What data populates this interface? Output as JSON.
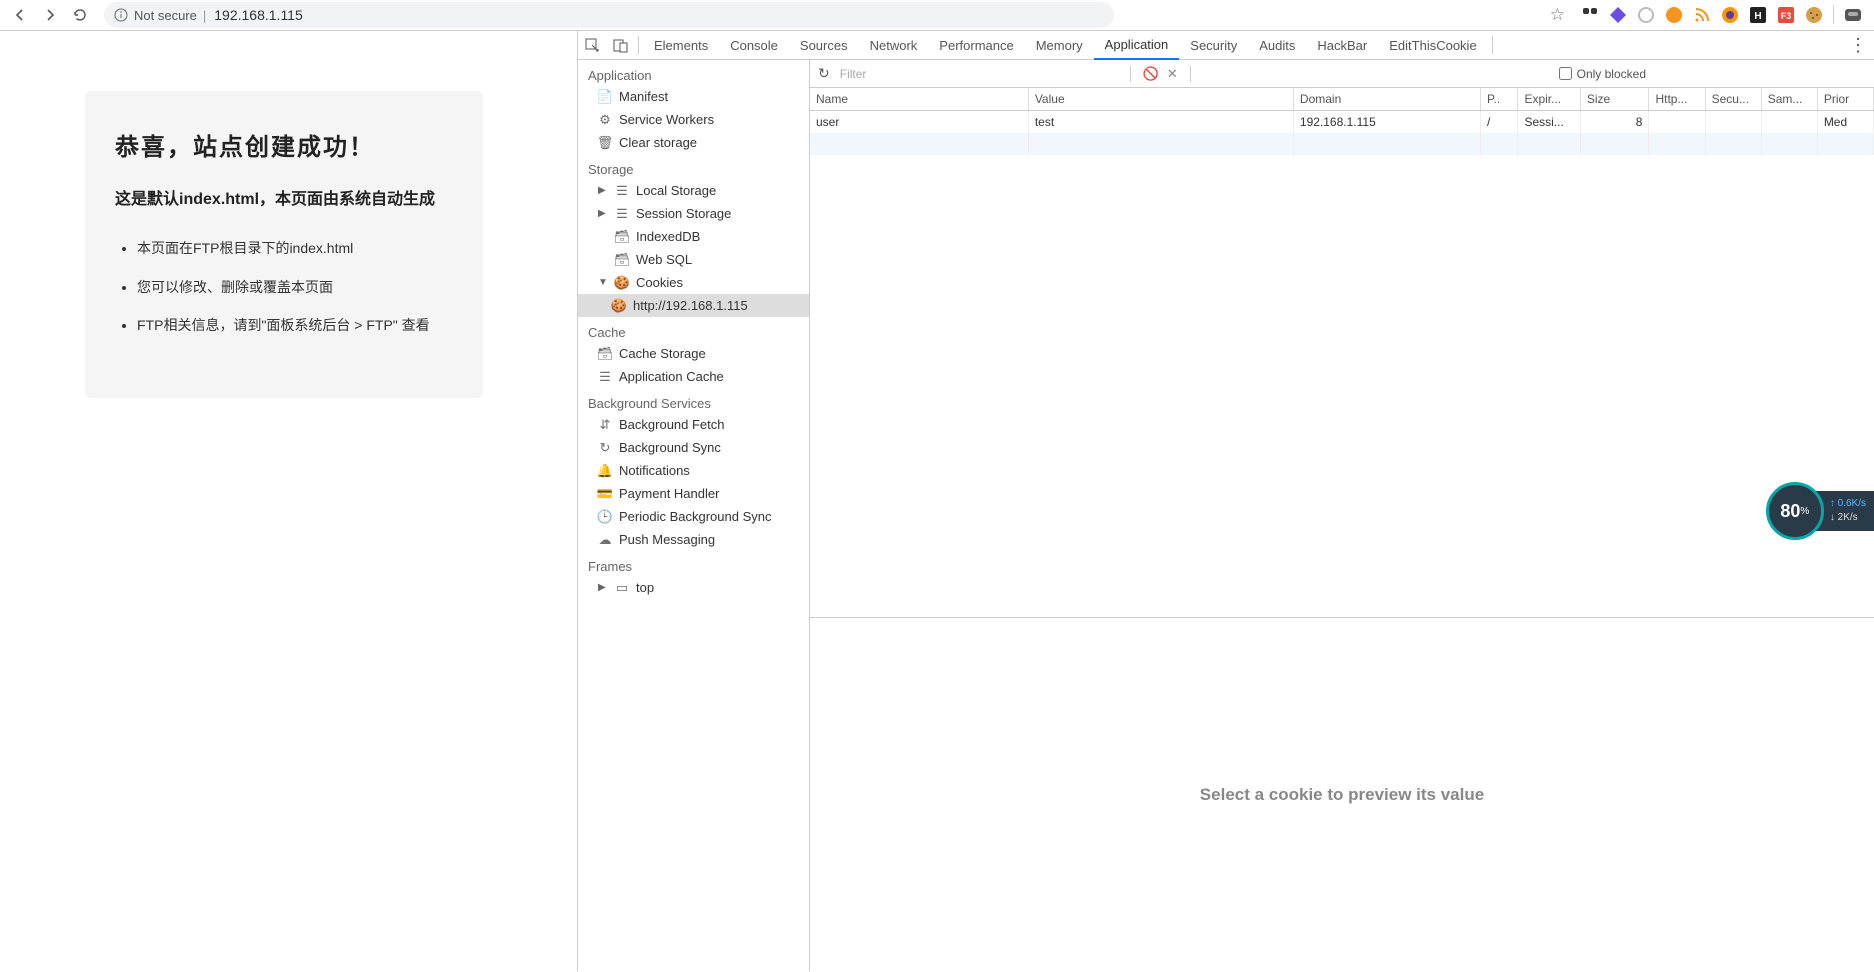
{
  "browser": {
    "not_secure": "Not secure",
    "url": "192.168.1.115"
  },
  "page": {
    "title": "恭喜，站点创建成功！",
    "subtitle": "这是默认index.html，本页面由系统自动生成",
    "items": [
      "本页面在FTP根目录下的index.html",
      "您可以修改、删除或覆盖本页面",
      "FTP相关信息，请到\"面板系统后台 > FTP\" 查看"
    ]
  },
  "devtools": {
    "tabs": [
      "Elements",
      "Console",
      "Sources",
      "Network",
      "Performance",
      "Memory",
      "Application",
      "Security",
      "Audits",
      "HackBar",
      "EditThisCookie"
    ],
    "active_tab": "Application",
    "sidebar": {
      "application": {
        "label": "Application",
        "items": [
          "Manifest",
          "Service Workers",
          "Clear storage"
        ]
      },
      "storage": {
        "label": "Storage",
        "items": [
          "Local Storage",
          "Session Storage",
          "IndexedDB",
          "Web SQL",
          "Cookies"
        ],
        "cookie_origin": "http://192.168.1.115"
      },
      "cache": {
        "label": "Cache",
        "items": [
          "Cache Storage",
          "Application Cache"
        ]
      },
      "bg": {
        "label": "Background Services",
        "items": [
          "Background Fetch",
          "Background Sync",
          "Notifications",
          "Payment Handler",
          "Periodic Background Sync",
          "Push Messaging"
        ]
      },
      "frames": {
        "label": "Frames",
        "items": [
          "top"
        ]
      }
    },
    "filter": {
      "placeholder": "Filter",
      "only_blocked": "Only blocked"
    },
    "table": {
      "cols": [
        "Name",
        "Value",
        "Domain",
        "P..",
        "Expir...",
        "Size",
        "Http...",
        "Secu...",
        "Sam...",
        "Prior"
      ],
      "widths": [
        140,
        170,
        120,
        24,
        40,
        44,
        36,
        36,
        36,
        36
      ],
      "rows": [
        {
          "name": "user",
          "value": "test",
          "domain": "192.168.1.115",
          "path": "/",
          "expires": "Sessi...",
          "size": "8",
          "http": "",
          "secure": "",
          "same": "",
          "priority": "Med"
        }
      ]
    },
    "preview": "Select a cookie to preview its value"
  },
  "speed": {
    "pct": "80",
    "unit": "%",
    "up": "0.6K/s",
    "down": "2K/s"
  }
}
